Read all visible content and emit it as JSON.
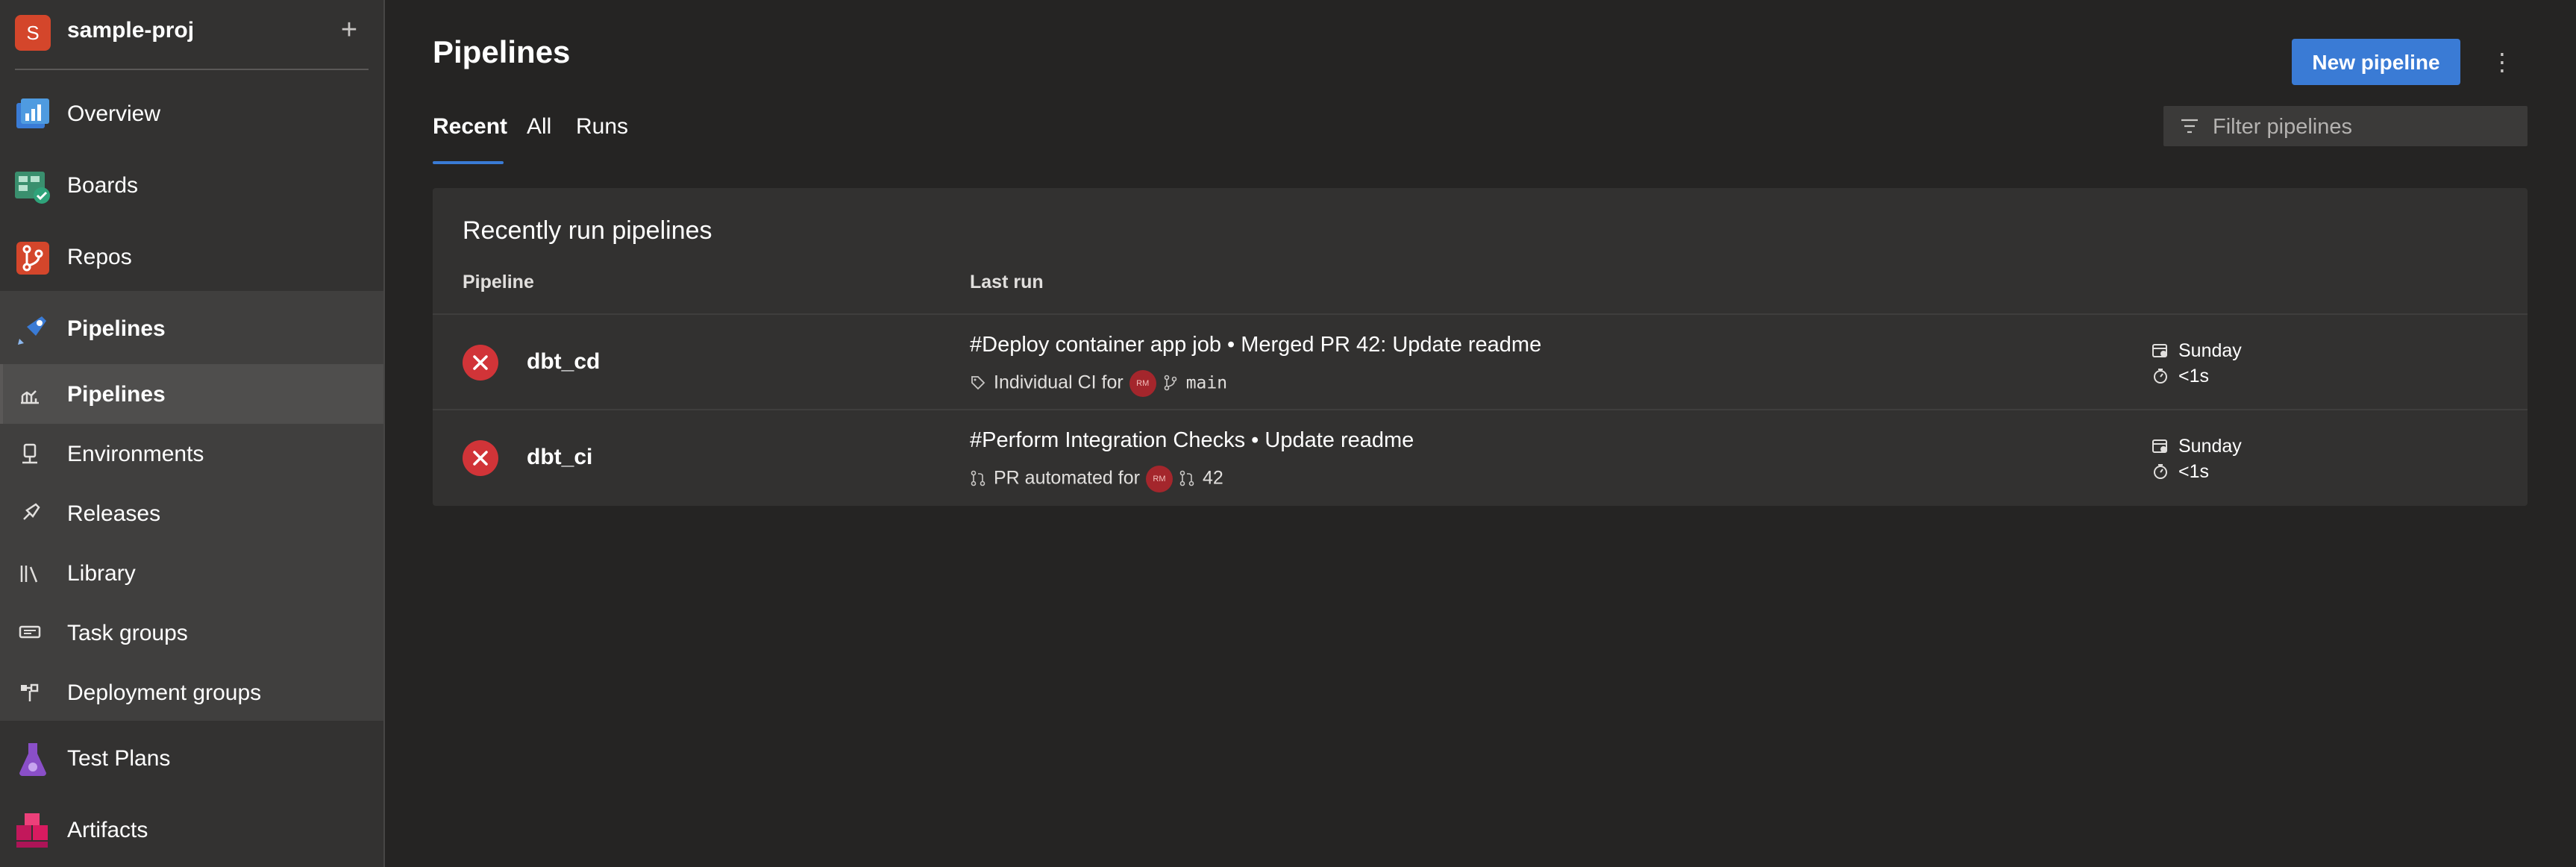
{
  "project": {
    "initial": "S",
    "name": "sample-proj",
    "add_label": "+"
  },
  "sidebar": {
    "items": [
      {
        "label": "Overview",
        "icon": "overview-icon"
      },
      {
        "label": "Boards",
        "icon": "boards-icon"
      },
      {
        "label": "Repos",
        "icon": "repos-icon"
      },
      {
        "label": "Pipelines",
        "icon": "pipelines-icon"
      },
      {
        "label": "Test Plans",
        "icon": "test-plans-icon"
      },
      {
        "label": "Artifacts",
        "icon": "artifacts-icon"
      }
    ],
    "pipelines_sub": [
      {
        "label": "Pipelines",
        "icon": "pipelines-sub-icon"
      },
      {
        "label": "Environments",
        "icon": "environments-icon"
      },
      {
        "label": "Releases",
        "icon": "releases-icon"
      },
      {
        "label": "Library",
        "icon": "library-icon"
      },
      {
        "label": "Task groups",
        "icon": "task-groups-icon"
      },
      {
        "label": "Deployment groups",
        "icon": "deployment-groups-icon"
      }
    ]
  },
  "page": {
    "title": "Pipelines",
    "new_button": "New pipeline",
    "more_label": "⋮",
    "tabs": [
      {
        "label": "Recent"
      },
      {
        "label": "All"
      },
      {
        "label": "Runs"
      }
    ],
    "filter_placeholder": "Filter pipelines"
  },
  "recent": {
    "title": "Recently run pipelines",
    "columns": {
      "pipeline": "Pipeline",
      "last_run": "Last run"
    },
    "rows": [
      {
        "name": "dbt_cd",
        "status": "failed",
        "run_title": "#Deploy container app job • Merged PR 42: Update readme",
        "trigger": "Individual CI for",
        "avatar": "RM",
        "ref": "main",
        "when": "Sunday",
        "duration": "<1s"
      },
      {
        "name": "dbt_ci",
        "status": "failed",
        "run_title": "#Perform Integration Checks • Update readme",
        "trigger": "PR automated for",
        "avatar": "RM",
        "ref": "42",
        "when": "Sunday",
        "duration": "<1s"
      }
    ]
  },
  "colors": {
    "accent": "#3a7bd5",
    "failed": "#d13438",
    "background": "#252423",
    "sidebar": "#333231"
  }
}
